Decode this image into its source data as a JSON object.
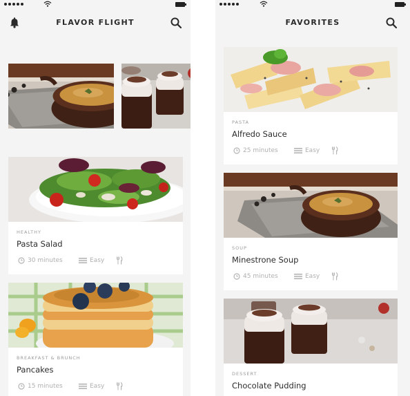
{
  "left_screen": {
    "title": "FLAVOR FLIGHT",
    "cards": [
      {
        "category": "HEALTHY",
        "title": "Pasta Salad",
        "time": "30 minutes",
        "difficulty": "Easy"
      },
      {
        "category": "BREAKFAST & BRUNCH",
        "title": "Pancakes",
        "time": "15 minutes",
        "difficulty": "Easy"
      }
    ]
  },
  "right_screen": {
    "title": "FAVORITES",
    "cards": [
      {
        "category": "PASTA",
        "title": "Alfredo Sauce",
        "time": "25 minutes",
        "difficulty": "Easy"
      },
      {
        "category": "SOUP",
        "title": "Minestrone Soup",
        "time": "45 minutes",
        "difficulty": "Easy"
      },
      {
        "category": "DESSERT",
        "title": "Chocolate Pudding"
      }
    ]
  },
  "icons": [
    "bell-icon",
    "search-icon",
    "clock-icon",
    "bars-icon",
    "utensils-icon",
    "wifi-icon",
    "battery-icon"
  ]
}
